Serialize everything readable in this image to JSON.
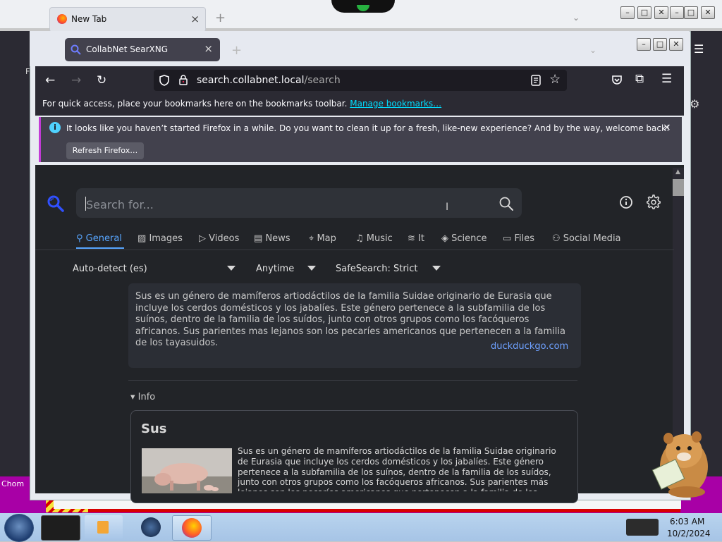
{
  "outer_window": {
    "tab_title": "New Tab",
    "tab_close": "×",
    "new_tab": "+",
    "partial_label": "Chom",
    "sidebar_letter": "F"
  },
  "window": {
    "tab_title": "CollabNet SearXNG",
    "tab_close": "×",
    "new_tab": "+"
  },
  "toolbar": {
    "url_host": "search.collabnet.local",
    "url_path": "/search"
  },
  "bookmarks_bar": {
    "text": "For quick access, place your bookmarks here on the bookmarks toolbar.",
    "link": "Manage bookmarks…"
  },
  "notification": {
    "message": "It looks like you haven’t started Firefox in a while. Do you want to clean it up for a fresh, like-new experience? And by the way, welcome back!",
    "button": "Refresh Firefox…",
    "close": "×"
  },
  "search": {
    "placeholder": "Search for..."
  },
  "categories": [
    {
      "label": "General",
      "icon": "search-icon",
      "selected": true
    },
    {
      "label": "Images",
      "icon": "image-icon"
    },
    {
      "label": "Videos",
      "icon": "play-icon"
    },
    {
      "label": "News",
      "icon": "newspaper-icon"
    },
    {
      "label": "Map",
      "icon": "map-pin-icon"
    },
    {
      "label": "Music",
      "icon": "music-note-icon"
    },
    {
      "label": "It",
      "icon": "layers-icon"
    },
    {
      "label": "Science",
      "icon": "graduation-cap-icon"
    },
    {
      "label": "Files",
      "icon": "file-drawer-icon"
    },
    {
      "label": "Social Media",
      "icon": "people-icon"
    }
  ],
  "filters": {
    "language": "Auto-detect (es)",
    "time": "Anytime",
    "safesearch": "SafeSearch: Strict"
  },
  "answer": {
    "text": "Sus es un género de mamíferos artiodáctilos de la familia Suidae originario de Eurasia que incluye los cerdos domésticos y los jabalíes. Este género pertenece a la subfamilia de los suínos, dentro de la familia de los suídos, junto con otros grupos como los facóqueros africanos. Sus parientes mas lejanos son los pecaríes americanos que pertenecen a la familia de los tayasuidos.",
    "source": "duckduckgo.com"
  },
  "info_section": {
    "toggle": "▾ Info",
    "title": "Sus",
    "text": "Sus es un género de mamíferos artiodáctilos de la familia Suidae originario de Eurasia que incluye los cerdos domésticos y los jabalíes. Este género pertenece a la subfamilia de los suínos, dentro de la familia de los suídos, junto con otros grupos como los facóqueros africanos. Sus parientes más lejanos son los pecaríes americanos que pertenecen a la familia de los tayasuidos."
  },
  "taskbar": {
    "time": "6:03 AM",
    "date": "10/2/2024"
  },
  "colors": {
    "accent": "#58a6ff",
    "link": "#00ddff",
    "notification_bar": "#c23bd6"
  }
}
